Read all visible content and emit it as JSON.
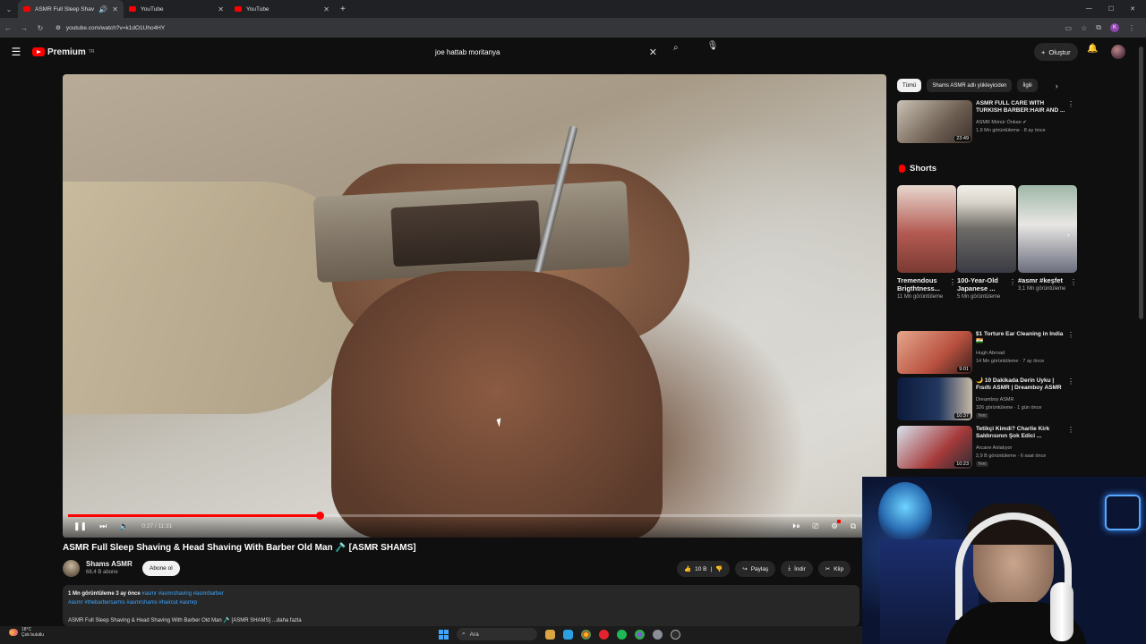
{
  "browser": {
    "tabs": [
      {
        "title": "ASMR Full Sleep Shaving & Head Shaving With Barber Old Man",
        "active": true
      },
      {
        "title": "YouTube",
        "active": false
      },
      {
        "title": "YouTube",
        "active": false
      }
    ],
    "url": "youtube.com/watch?v=k1dO1Uho4HY"
  },
  "masthead": {
    "logo_text": "Premium",
    "logo_sup": "TR",
    "search_value": "joe hattab moritanya",
    "create_label": "Oluştur"
  },
  "player": {
    "time": "0:27 / 11:31",
    "progress_fraction": 0.31
  },
  "video": {
    "title": "ASMR Full Sleep Shaving & Head Shaving With Barber Old Man 🪒 [ASMR SHAMS]",
    "channel": "Shams ASMR",
    "subscribers": "68,4 B abone",
    "subscribe_label": "Abone ol",
    "likes": "10 B",
    "share_label": "Paylaş",
    "download_label": "İndir",
    "clip_label": "Klip",
    "desc_meta": "1 Mn görüntüleme  3 ay önce",
    "desc_meta_tags": "#asmr #asmrshaving #asmrbarber",
    "desc_tags": "#asmr #thebarbersarms #asmrshams #haircut #asmrp",
    "desc_line": "ASMR Full Sleep Shaving & Head Shaving With Barber Old Man 🪒 [ASMR SHAMS] ...daha fazla"
  },
  "chips": [
    "Tümü",
    "Shams ASMR adlı yükleyiciden",
    "İlgili"
  ],
  "recs": [
    {
      "title": "ASMR FULL CARE WITH TURKISH BARBER:HAIR AND ...",
      "channel": "ASMR Münür Önkan ✔",
      "meta": "1,9 Mn görüntüleme · 8 ay önce",
      "duration": "23:49",
      "new": ""
    },
    {
      "title": "$1 Torture Ear Cleaning in India 🇮🇳",
      "channel": "Hugh Abroad",
      "meta": "14 Mn görüntüleme · 7 ay önce",
      "duration": "9:01",
      "new": ""
    },
    {
      "title": "🌙 10 Dakikada Derin Uyku | Fısıltı ASMR | Dreamboy ASMR",
      "channel": "Dreamboy ASMR",
      "meta": "326 görüntüleme · 1 gün önce",
      "duration": "10:37",
      "new": "Yeni"
    },
    {
      "title": "Tetikçi Kimdi? Charlie Kirk Saldırısının Şok Edici ...",
      "channel": "Arcane Anlatıyor",
      "meta": "2,9 B görüntüleme · 6 saat önce",
      "duration": "10:23",
      "new": "Yeni"
    }
  ],
  "shorts": {
    "heading": "Shorts",
    "items": [
      {
        "title": "Tremendous Brigthtness...",
        "views": "11 Mn görüntüleme"
      },
      {
        "title": "100-Year-Old Japanese ...",
        "views": "5 Mn görüntüleme"
      },
      {
        "title": "#asmr #keşfet",
        "views": "3,1 Mn görüntüleme"
      }
    ]
  },
  "taskbar": {
    "temp": "18°C",
    "weather": "Çok bulutlu",
    "search_label": "Ara"
  },
  "colors": {
    "accent": "#ff0000",
    "link": "#3ea6ff",
    "background": "#0f0f0f"
  }
}
